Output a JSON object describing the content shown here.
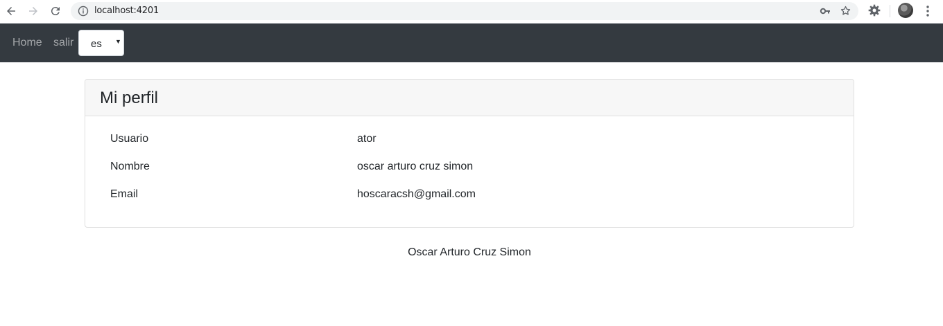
{
  "browser": {
    "url": "localhost:4201",
    "icons": {
      "back": "arrow-left-icon",
      "forward": "arrow-right-icon",
      "reload": "reload-icon",
      "info": "info-icon",
      "key": "key-icon",
      "star": "star-icon",
      "extension": "gear-icon",
      "profile": "avatar",
      "menu": "kebab-menu-icon"
    }
  },
  "navbar": {
    "home_label": "Home",
    "logout_label": "salir",
    "language": {
      "selected": "es"
    },
    "bg_color": "#343a40"
  },
  "profile": {
    "title": "Mi perfil",
    "fields": [
      {
        "label": "Usuario",
        "value": "ator"
      },
      {
        "label": "Nombre",
        "value": "oscar arturo cruz simon"
      },
      {
        "label": "Email",
        "value": "hoscaracsh@gmail.com"
      }
    ]
  },
  "footer": {
    "text": "Oscar Arturo Cruz Simon"
  }
}
